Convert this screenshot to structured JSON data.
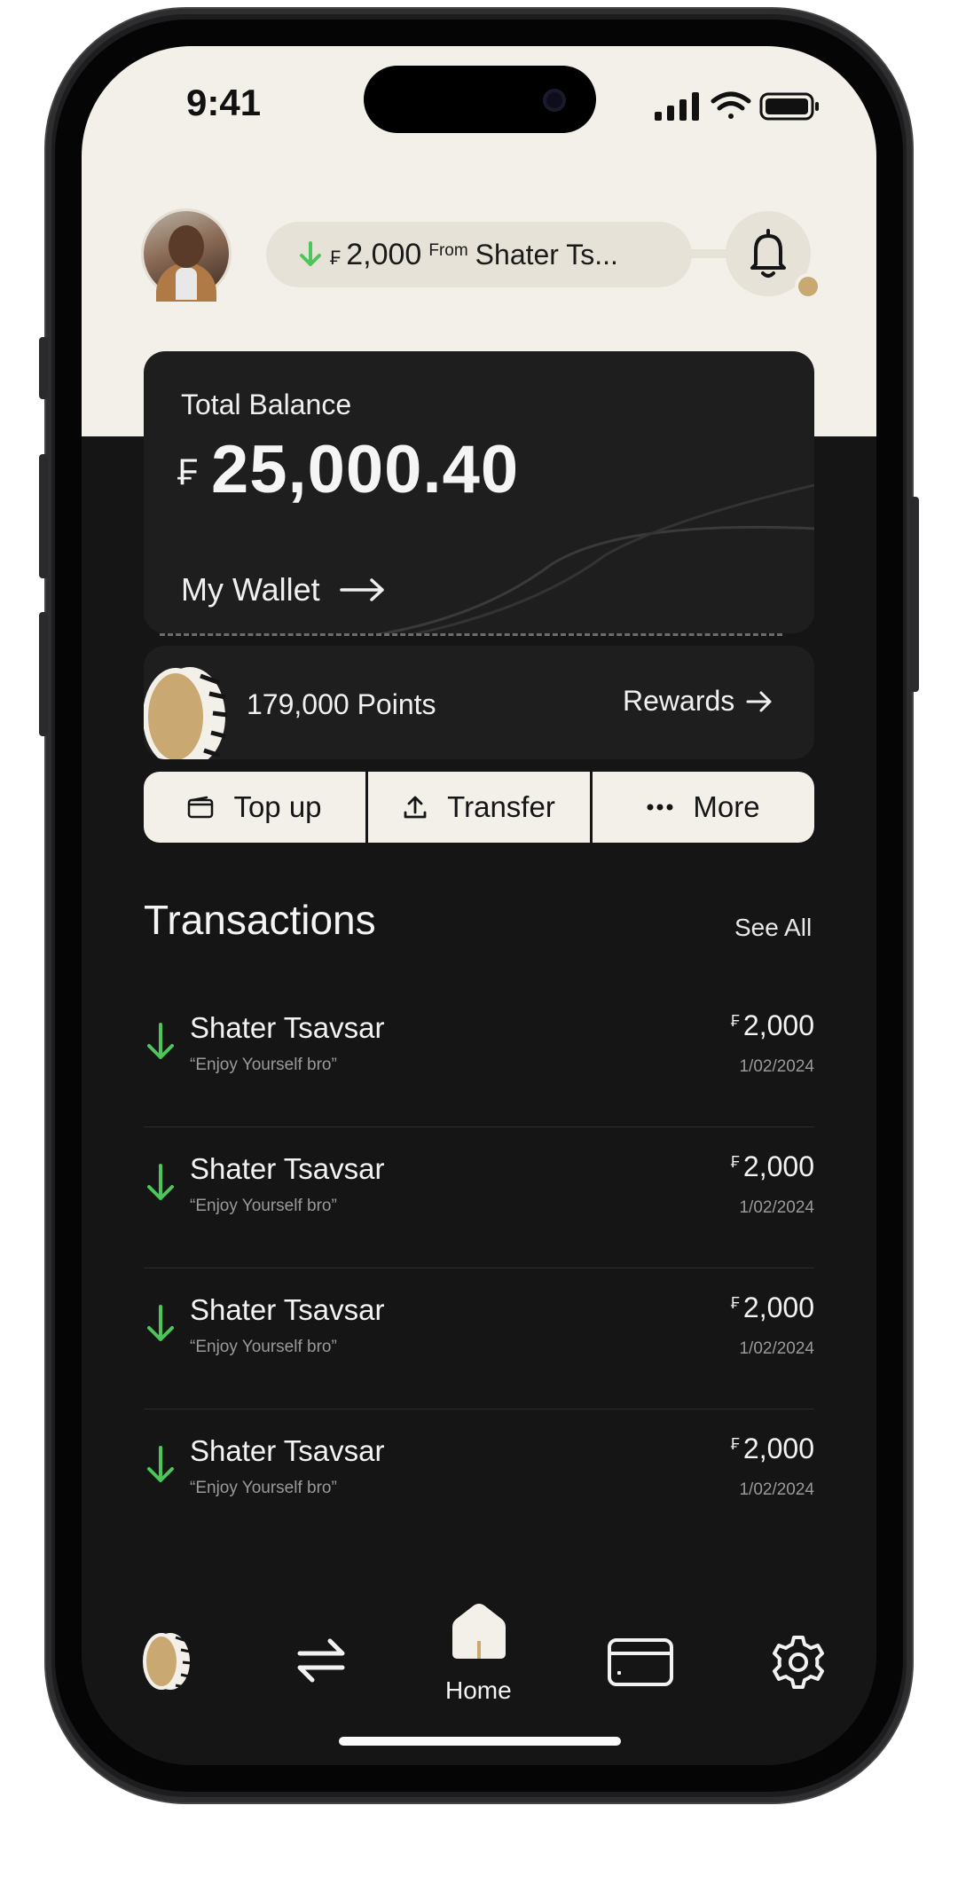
{
  "status_bar": {
    "time": "9:41"
  },
  "header": {
    "notification": {
      "currency": "₣",
      "amount": "2,000",
      "from_label": "From",
      "name": "Shater Ts..."
    }
  },
  "balance": {
    "label": "Total Balance",
    "currency": "₣",
    "amount": "25,000.40",
    "wallet_link": "My Wallet"
  },
  "points": {
    "text": "179,000 Points",
    "rewards_label": "Rewards"
  },
  "actions": {
    "top_up": "Top up",
    "transfer": "Transfer",
    "more": "More"
  },
  "transactions": {
    "title": "Transactions",
    "see_all": "See All",
    "items": [
      {
        "name": "Shater Tsavsar",
        "memo": "“Enjoy Yourself bro”",
        "currency": "₣",
        "amount": "2,000",
        "date": "1/02/2024"
      },
      {
        "name": "Shater Tsavsar",
        "memo": "“Enjoy Yourself bro”",
        "currency": "₣",
        "amount": "2,000",
        "date": "1/02/2024"
      },
      {
        "name": "Shater Tsavsar",
        "memo": "“Enjoy Yourself bro”",
        "currency": "₣",
        "amount": "2,000",
        "date": "1/02/2024"
      },
      {
        "name": "Shater Tsavsar",
        "memo": "“Enjoy Yourself bro”",
        "currency": "₣",
        "amount": "2,000",
        "date": "1/02/2024"
      }
    ]
  },
  "nav": {
    "home_label": "Home",
    "icons": [
      "coin-icon",
      "transfer-arrows-icon",
      "home-icon",
      "card-icon",
      "settings-gear-icon"
    ]
  },
  "colors": {
    "accent_green": "#4cc65a",
    "gold": "#c9a971",
    "cream": "#f3f0ea",
    "dark_bg": "#151515",
    "card_bg": "#1e1e1e"
  }
}
